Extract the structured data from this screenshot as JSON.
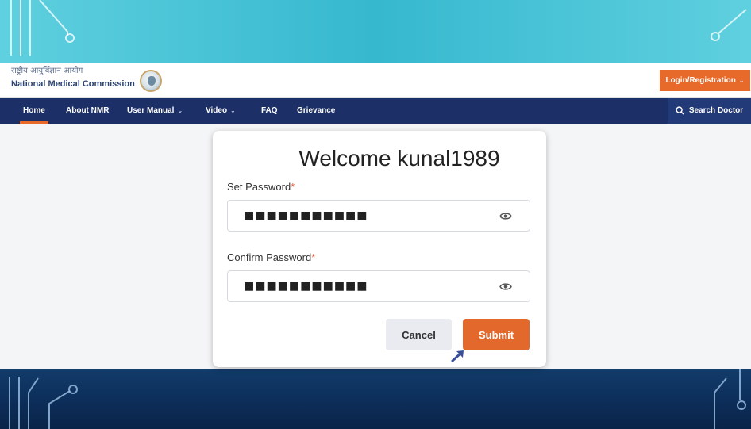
{
  "header": {
    "brand_hindi": "राष्ट्रीय आयुर्विज्ञान आयोग",
    "brand_english": "National Medical Commission",
    "login_label": "Login/Registration"
  },
  "nav": {
    "items": [
      {
        "label": "Home",
        "has_dropdown": false,
        "active": true
      },
      {
        "label": "About NMR",
        "has_dropdown": false
      },
      {
        "label": "User Manual",
        "has_dropdown": true
      },
      {
        "label": "Video",
        "has_dropdown": true
      },
      {
        "label": "FAQ",
        "has_dropdown": false
      },
      {
        "label": "Grievance",
        "has_dropdown": false
      }
    ],
    "search_label": "Search Doctor"
  },
  "form": {
    "title": "Welcome kunal1989",
    "set_password_label": "Set Password",
    "set_password_value": "■■■■■■■■■■■",
    "confirm_password_label": "Confirm Password",
    "confirm_password_value": "■■■■■■■■■■■",
    "required_marker": "*",
    "cancel_label": "Cancel",
    "submit_label": "Submit"
  },
  "colors": {
    "accent_orange": "#e86a2b",
    "nav_navy": "#1c2f66",
    "banner_teal": "#36b8cf",
    "banner_dark": "#0c2c57"
  },
  "icons": {
    "eye": "eye-icon",
    "search": "search-icon",
    "chevron": "chevron-down-icon",
    "cursor": "pointer-arrow-icon"
  }
}
